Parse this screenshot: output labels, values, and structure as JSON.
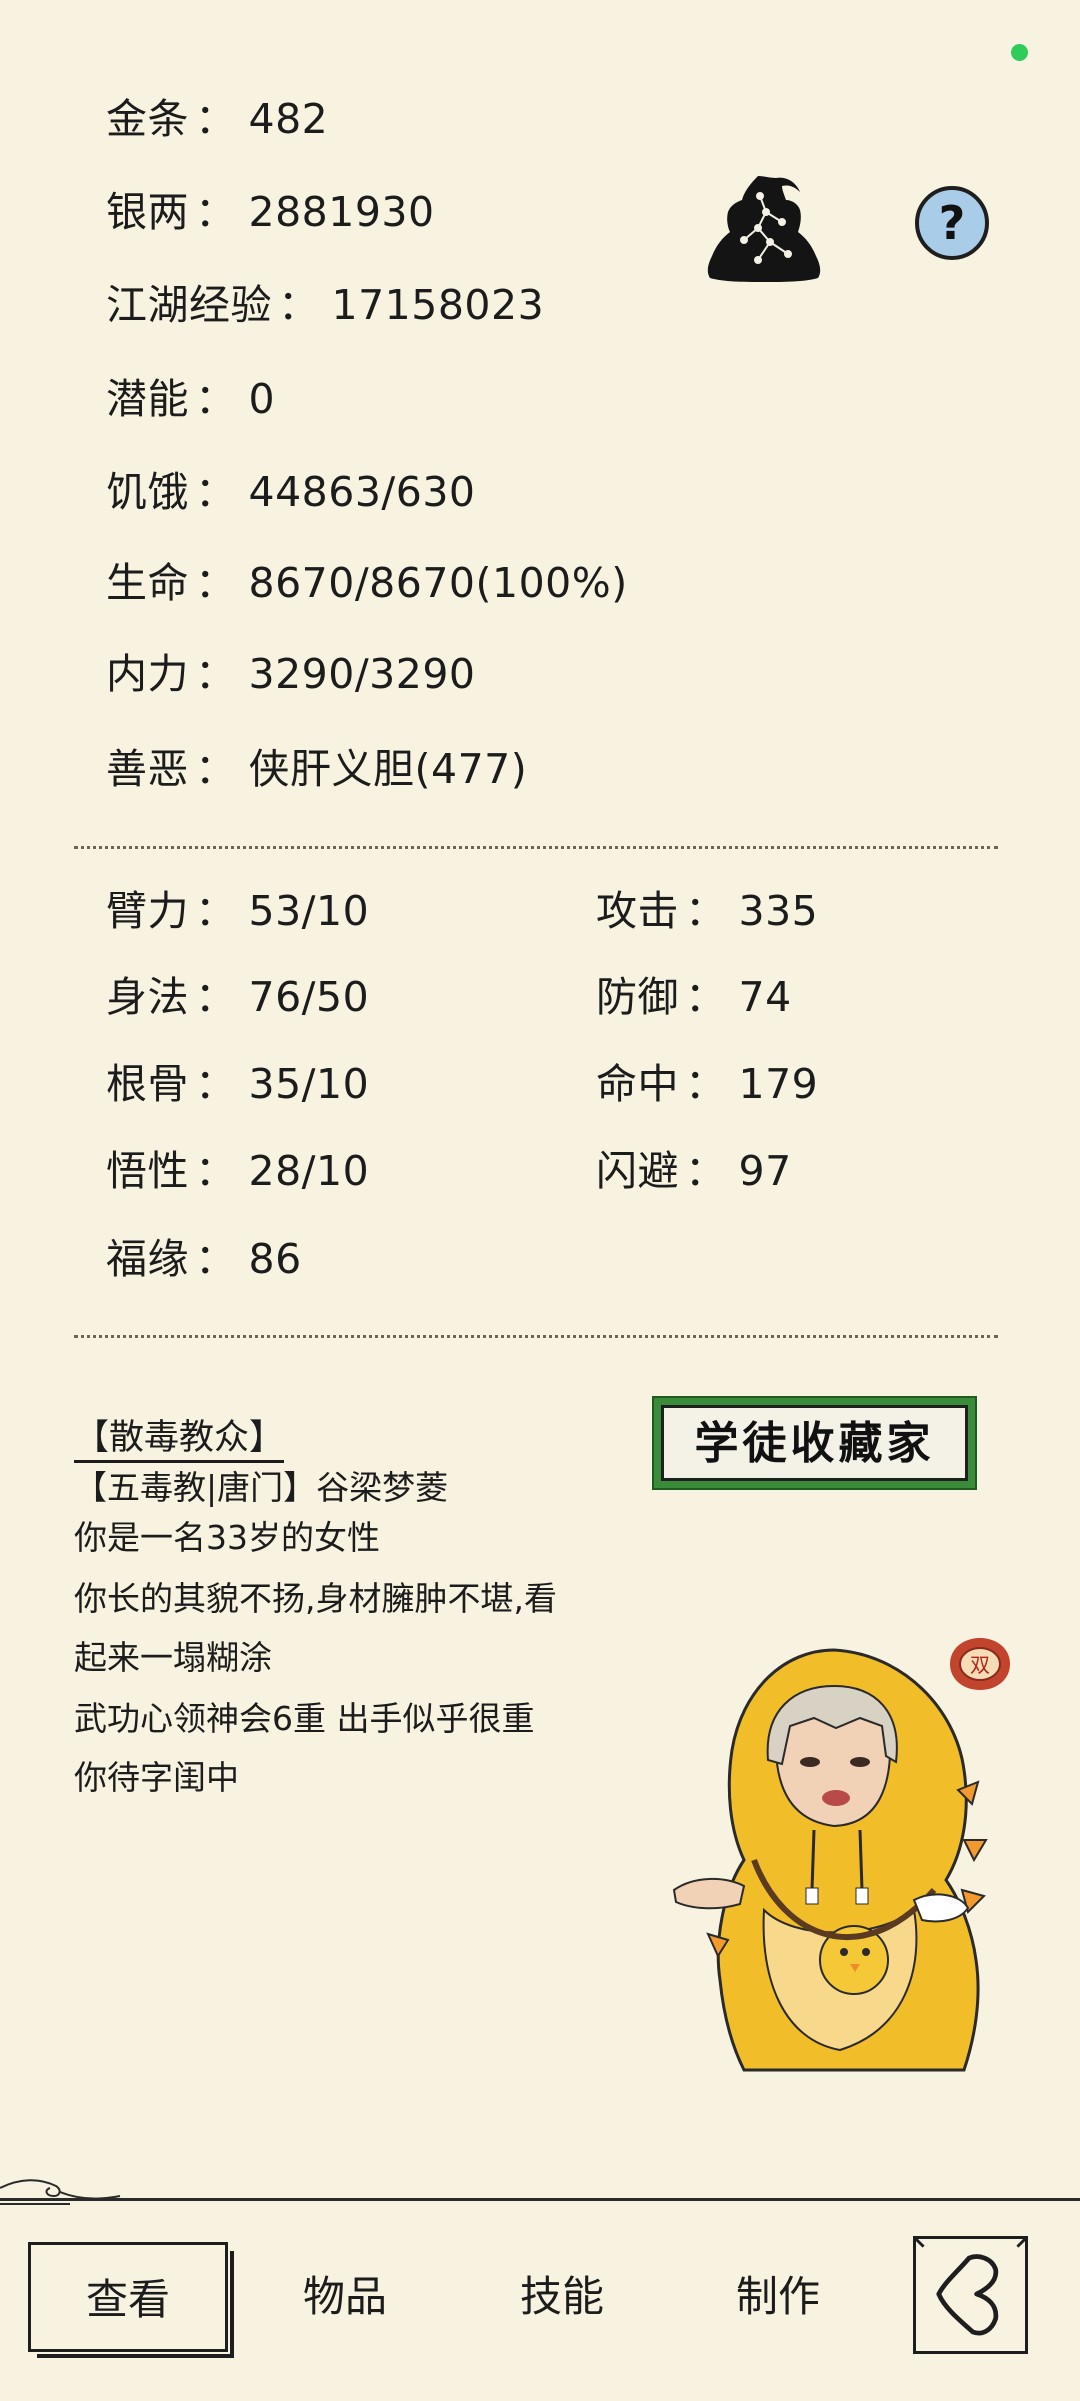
{
  "separator": "：",
  "stats_top": [
    {
      "label": "金条",
      "value": "482"
    },
    {
      "label": "银两",
      "value": "2881930"
    },
    {
      "label": "江湖经验",
      "value": "17158023"
    },
    {
      "label": "潜能",
      "value": "0"
    },
    {
      "label": "饥饿",
      "value": "44863/630"
    },
    {
      "label": "生命",
      "value": "8670/8670(100%)"
    },
    {
      "label": "内力",
      "value": "3290/3290"
    },
    {
      "label": "善恶",
      "value": "侠肝义胆(477)"
    }
  ],
  "attributes_left": [
    {
      "label": "臂力",
      "value": "53/10"
    },
    {
      "label": "身法",
      "value": "76/50"
    },
    {
      "label": "根骨",
      "value": "35/10"
    },
    {
      "label": "悟性",
      "value": "28/10"
    },
    {
      "label": "福缘",
      "value": "86"
    }
  ],
  "attributes_right": [
    {
      "label": "攻击",
      "value": "335"
    },
    {
      "label": "防御",
      "value": "74"
    },
    {
      "label": "命中",
      "value": "179"
    },
    {
      "label": "闪避",
      "value": "97"
    }
  ],
  "profile": {
    "section_title": "【散毒教众】",
    "line1": "【五毒教|唐门】谷梁梦菱",
    "line2": "你是一名33岁的女性",
    "line3": "你长的其貌不扬,身材臃肿不堪,看",
    "line4": "起来一塌糊涂",
    "line5": "武功心领神会6重 出手似乎很重",
    "line6": "你待字闺中"
  },
  "badge_text": "学徒收藏家",
  "seal_text": "双",
  "help_label": "?",
  "nav": {
    "view": "查看",
    "items": "物品",
    "skills": "技能",
    "craft": "制作"
  },
  "colors": {
    "background": "#f8f2e1",
    "status_dot": "#2ecc5a",
    "badge_green": "#3b8c3a",
    "help_blue": "#a9cde8",
    "character_yellow": "#f1be2a"
  }
}
